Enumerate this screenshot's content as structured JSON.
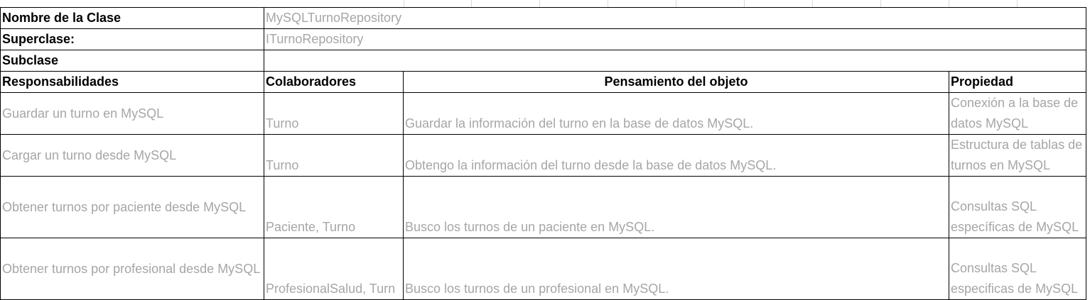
{
  "class_info": {
    "name_label": "Nombre de la Clase",
    "name_value": "MySQLTurnoRepository",
    "superclass_label": "Superclase:",
    "superclass_value": "ITurnoRepository",
    "subclass_label": "Subclase",
    "subclass_value": ""
  },
  "headers": {
    "responsibilities": "Responsabilidades",
    "collaborators": "Colaboradores",
    "thinking": "Pensamiento del objeto",
    "property": "Propiedad"
  },
  "rows": [
    {
      "responsibility": "Guardar un turno en MySQL",
      "collaborators": "Turno",
      "thinking": "Guardar la información del turno en la base de datos MySQL.",
      "property": "Conexión a la base de datos MySQL"
    },
    {
      "responsibility": "Cargar un turno desde MySQL",
      "collaborators": "Turno",
      "thinking": "Obtengo la información del turno desde la base de datos MySQL.",
      "property": "Estructura de tablas de turnos en MySQL"
    },
    {
      "responsibility": "Obtener turnos por paciente desde MySQL",
      "collaborators": "Paciente, Turno",
      "thinking": "Busco los turnos de un paciente en MySQL.",
      "property": "Consultas SQL específicas de MySQL"
    },
    {
      "responsibility": "Obtener turnos por profesional desde MySQL",
      "collaborators": "ProfesionalSalud, Turn",
      "thinking": "Busco los turnos de un profesional en MySQL.",
      "property": "Consultas SQL especificas de MySQL"
    }
  ]
}
